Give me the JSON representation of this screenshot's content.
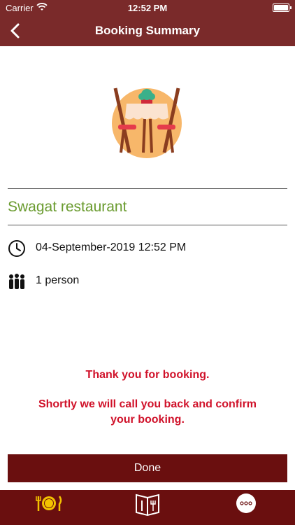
{
  "status_bar": {
    "carrier": "Carrier",
    "time": "12:52 PM"
  },
  "nav": {
    "title": "Booking Summary",
    "back_icon": "chevron-left-icon"
  },
  "booking": {
    "restaurant_name": "Swagat restaurant",
    "datetime": "04-September-2019 12:52 PM",
    "guests": "1 person"
  },
  "message": {
    "line1": "Thank you for booking.",
    "line2": "Shortly we will call you back and confirm your booking."
  },
  "buttons": {
    "done_label": "Done"
  },
  "tabbar": {
    "items": [
      {
        "icon": "plate-cutlery-icon"
      },
      {
        "icon": "menu-book-icon"
      },
      {
        "icon": "more-icon"
      }
    ]
  },
  "colors": {
    "header": "#7a2a2a",
    "button": "#6a0f0f",
    "restaurant_name": "#6a9b2f",
    "message": "#d0122a",
    "tab_active": "#f2c200"
  }
}
